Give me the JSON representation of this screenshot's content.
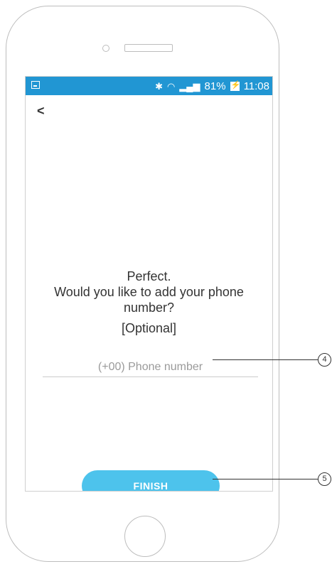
{
  "status_bar": {
    "battery": "81%",
    "time": "11:08"
  },
  "prompt": {
    "line1": "Perfect.",
    "line2": "Would you like to add your phone",
    "line3": "number?",
    "optional": "[Optional]"
  },
  "phone_field": {
    "placeholder": "(+00) Phone number",
    "value": ""
  },
  "finish_label": "FINISH",
  "annotations": {
    "input_callout": "4",
    "button_callout": "5"
  },
  "colors": {
    "status_bar": "#2196d3",
    "button": "#4dc3ec"
  }
}
